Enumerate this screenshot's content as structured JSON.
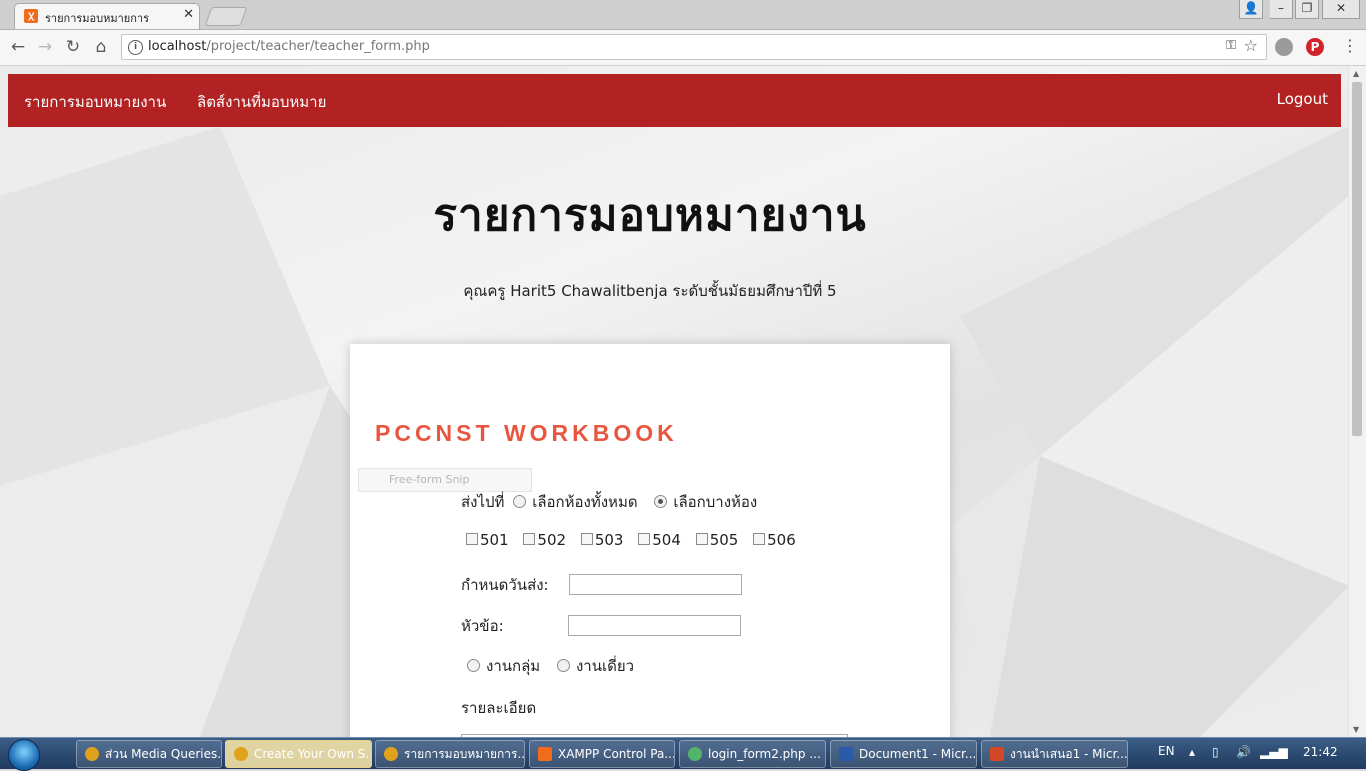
{
  "browser": {
    "tab_title": "รายการมอบหมายการ",
    "url_host": "localhost",
    "url_path": "/project/teacher/teacher_form.php"
  },
  "site_nav": {
    "left_links": [
      "รายการมอบหมายงาน",
      "ลิตส์งานที่มอบหมาย"
    ],
    "logout": "Logout"
  },
  "page": {
    "title": "รายการมอบหมายงาน",
    "teacher_line": "คุณครู Harit5 Chawalitbenja ระดับชั้นมัธยมศึกษาปีที่ 5"
  },
  "form": {
    "brand": "PCCNST WORKBOOK",
    "snip_ghost": "Free-form Snip",
    "send_to_label": "ส่งไปที่",
    "send_options": [
      {
        "label": "เลือกห้องทั้งหมด",
        "checked": false
      },
      {
        "label": "เลือกบางห้อง",
        "checked": true
      }
    ],
    "rooms": [
      "501",
      "502",
      "503",
      "504",
      "505",
      "506"
    ],
    "due_label": "กำหนดวันส่ง:",
    "due_value": "",
    "topic_label": "หัวข้อ:",
    "topic_value": "",
    "work_types": [
      {
        "label": "งานกลุ่ม",
        "checked": false
      },
      {
        "label": "งานเดี่ยว",
        "checked": false
      }
    ],
    "detail_label": "รายละเอียด"
  },
  "taskbar": {
    "tasks": [
      "ส่วน Media Queries...",
      "Create Your Own S...",
      "รายการมอบหมายการ...",
      "XAMPP Control Pa...",
      "login_form2.php ...",
      "Document1 - Micr...",
      "งานนำเสนอ1 - Micr..."
    ],
    "language": "EN",
    "clock": "21:42"
  },
  "colors": {
    "nav_red": "#b22222",
    "brand_orange": "#e8563f"
  }
}
